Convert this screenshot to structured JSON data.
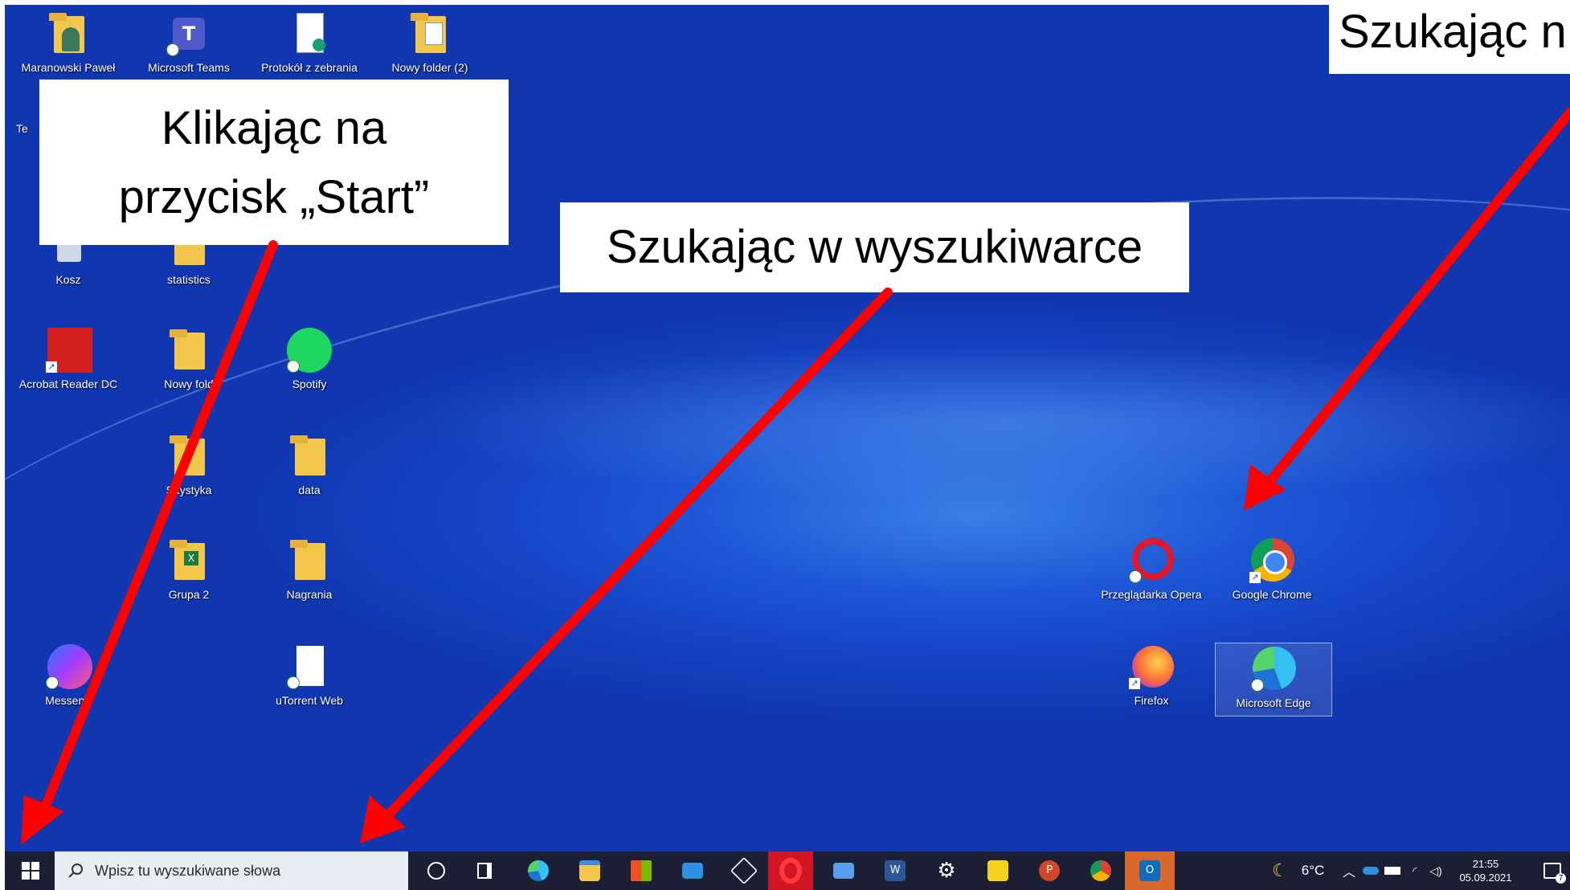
{
  "desktop_icons": [
    {
      "label": "Maranowski Paweł"
    },
    {
      "label": "Microsoft Teams"
    },
    {
      "label": "Protokół z zebrania"
    },
    {
      "label": "Nowy folder (2)"
    },
    {
      "label": "Te"
    },
    {
      "label": "Kosz"
    },
    {
      "label": "statistics"
    },
    {
      "label": "Acrobat Reader DC"
    },
    {
      "label": "Nowy fold"
    },
    {
      "label": "Spotify"
    },
    {
      "label": "S  tystyka"
    },
    {
      "label": "data"
    },
    {
      "label": "Grupa 2"
    },
    {
      "label": "Nagrania"
    },
    {
      "label": "Messen   r"
    },
    {
      "label": "uTorrent Web"
    },
    {
      "label": "Przeglądarka Opera"
    },
    {
      "label": "Google Chrome"
    },
    {
      "label": "Firefox"
    },
    {
      "label": "Microsoft Edge"
    }
  ],
  "callouts": {
    "start_line1": "Klikając na",
    "start_line2": "przycisk „Start”",
    "search": "Szukając w wyszukiwarce",
    "desktop": "Szukając n"
  },
  "taskbar": {
    "search_placeholder": "Wpisz tu wyszukiwane słowa",
    "weather": "6°C",
    "time": "21:55",
    "date": "05.09.2021",
    "notifications": "7",
    "icons": [
      "windows-start-icon",
      "search-icon",
      "cortana-icon",
      "task-view-icon",
      "edge-icon",
      "file-explorer-icon",
      "store-icon",
      "mail-icon",
      "package-icon",
      "opera-icon",
      "remote-desktop-icon",
      "word-icon",
      "settings-icon",
      "sticky-notes-icon",
      "powerpoint-icon",
      "chrome-icon",
      "outlook-icon"
    ]
  },
  "colors": {
    "arrow": "#ff0000",
    "taskbar": "#1c1f33",
    "desktop": "#1543c4"
  }
}
